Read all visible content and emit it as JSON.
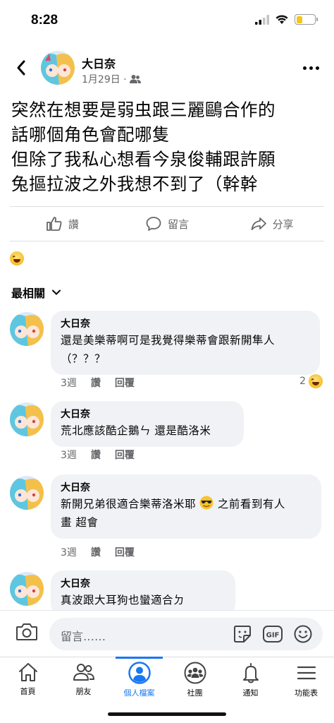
{
  "status_bar": {
    "time": "8:28",
    "battery_level": 0.35
  },
  "post": {
    "author": "大日奈",
    "date": "1月29日 ·",
    "privacy_icon": "friends-icon",
    "text_lines": [
      "突然在想要是弱虫跟三麗鷗合作的",
      "話哪個角色會配哪隻",
      "但除了我私心想看今泉俊輔跟許願",
      "兔摳拉波之外我想不到了（幹幹"
    ]
  },
  "actions": {
    "like": "讚",
    "comment": "留言",
    "share": "分享"
  },
  "sort": {
    "label": "最相關"
  },
  "comments": [
    {
      "author": "大日奈",
      "lines": [
        "還是美樂蒂啊可是我覺得樂蒂會跟新開隼人",
        "（？？？"
      ],
      "time": "3週",
      "like": "讚",
      "reply": "回覆",
      "reactions": "2"
    },
    {
      "author": "大日奈",
      "lines": [
        "荒北應該酷企鵝ㄣ 還是酷洛米"
      ],
      "time": "3週",
      "like": "讚",
      "reply": "回覆"
    },
    {
      "author": "大日奈",
      "lines": [
        "新開兄弟很適合樂蒂洛米耶",
        "之前看到有人",
        "畫 超會"
      ],
      "time": "3週",
      "like": "讚",
      "reply": "回覆"
    },
    {
      "author": "大日奈",
      "lines": [
        "真波跟大耳狗也蠻適合ㄉ"
      ]
    }
  ],
  "composer": {
    "placeholder": "留言……",
    "gif_label": "GIF"
  },
  "tabs": [
    {
      "label": "首頁",
      "icon": "home-icon"
    },
    {
      "label": "朋友",
      "icon": "friends-icon"
    },
    {
      "label": "個人檔案",
      "icon": "profile-icon"
    },
    {
      "label": "社團",
      "icon": "groups-icon"
    },
    {
      "label": "通知",
      "icon": "bell-icon"
    },
    {
      "label": "功能表",
      "icon": "menu-icon"
    }
  ],
  "colors": {
    "accent": "#1877f2",
    "bubble": "#f0f2f5",
    "secondary_text": "#65676b"
  }
}
